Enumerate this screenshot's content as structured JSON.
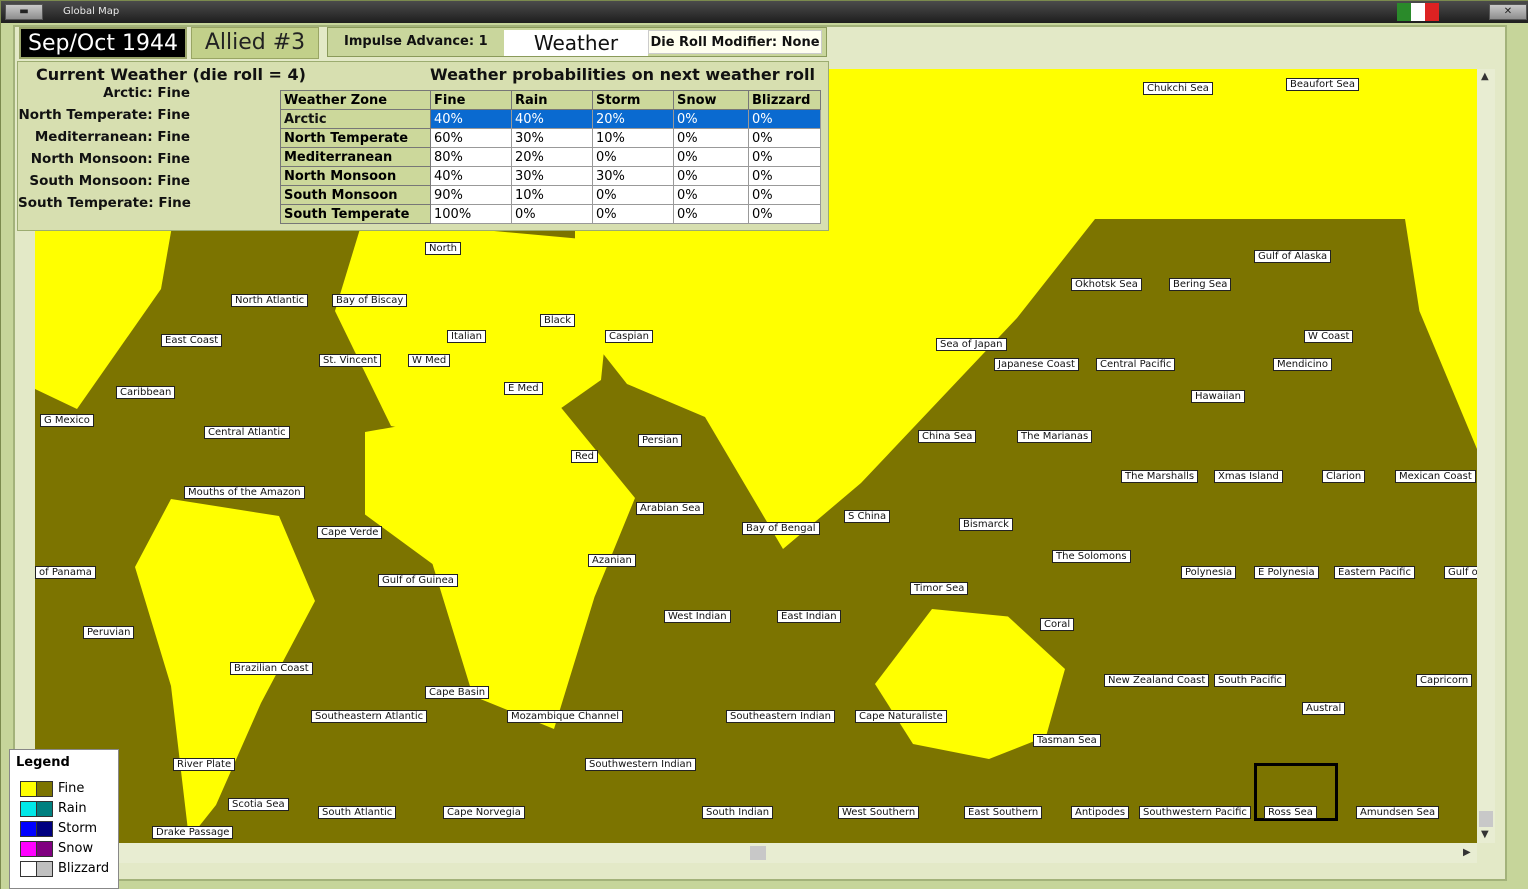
{
  "window": {
    "title": "Global Map",
    "minimize_label": "▬",
    "close_label": "✕"
  },
  "header": {
    "date": "Sep/Oct 1944",
    "side": "Allied #3",
    "impulse_advance": "Impulse Advance:  1",
    "weather_button": "Weather",
    "die_roll_modifier": "Die Roll Modifier:  None"
  },
  "current_weather": {
    "title": "Current Weather (die roll = 4)",
    "rows": [
      {
        "zone": "Arctic:",
        "value": "Fine"
      },
      {
        "zone": "North Temperate:",
        "value": "Fine"
      },
      {
        "zone": "Mediterranean:",
        "value": "Fine"
      },
      {
        "zone": "North Monsoon:",
        "value": "Fine"
      },
      {
        "zone": "South Monsoon:",
        "value": "Fine"
      },
      {
        "zone": "South Temperate:",
        "value": "Fine"
      }
    ]
  },
  "probabilities": {
    "title": "Weather probabilities on next weather roll",
    "headers": [
      "Weather Zone",
      "Fine",
      "Rain",
      "Storm",
      "Snow",
      "Blizzard"
    ],
    "rows": [
      [
        "Arctic",
        "40%",
        "40%",
        "20%",
        "0%",
        "0%"
      ],
      [
        "North Temperate",
        "60%",
        "30%",
        "10%",
        "0%",
        "0%"
      ],
      [
        "Mediterranean",
        "80%",
        "20%",
        "0%",
        "0%",
        "0%"
      ],
      [
        "North Monsoon",
        "40%",
        "30%",
        "30%",
        "0%",
        "0%"
      ],
      [
        "South Monsoon",
        "90%",
        "10%",
        "0%",
        "0%",
        "0%"
      ],
      [
        "South Temperate",
        "100%",
        "0%",
        "0%",
        "0%",
        "0%"
      ]
    ],
    "selected_row": "Arctic"
  },
  "map": {
    "colors": {
      "fine_land": "#ffff00",
      "fine_sea": "#7c7400"
    },
    "zones": [
      "Chukchi Sea",
      "Beaufort Sea",
      "North",
      "North Atlantic",
      "Bay of Biscay",
      "Black",
      "Caspian",
      "Italian",
      "East Coast",
      "St. Vincent",
      "W Med",
      "E Med",
      "Sea of Japan",
      "Okhotsk Sea",
      "Bering Sea",
      "Gulf of Alaska",
      "Japanese Coast",
      "Central Pacific",
      "W Coast",
      "Mendicino",
      "Caribbean",
      "Hawaiian",
      "G Mexico",
      "Central Atlantic",
      "Persian",
      "China Sea",
      "The Marianas",
      "Red",
      "The Marshalls",
      "Xmas Island",
      "Clarion",
      "Mexican Coast",
      "Mouths of the Amazon",
      "Arabian Sea",
      "S China",
      "Bismarck",
      "Cape Verde",
      "Bay of Bengal",
      "Azanian",
      "The Solomons",
      "of Panama",
      "Gulf of Guinea",
      "Polynesia",
      "E Polynesia",
      "Eastern Pacific",
      "Gulf o",
      "Timor Sea",
      "West Indian",
      "East Indian",
      "Peruvian",
      "Coral",
      "Brazilian Coast",
      "New Zealand Coast",
      "South Pacific",
      "Capricorn",
      "Cape Basin",
      "Austral",
      "Southeastern Atlantic",
      "Mozambique Channel",
      "Southeastern Indian",
      "Cape Naturaliste",
      "Tasman Sea",
      "River Plate",
      "Southwestern Indian",
      "Scotia Sea",
      "South Atlantic",
      "Cape Norvegia",
      "South Indian",
      "West Southern",
      "East Southern",
      "Antipodes",
      "Southwestern Pacific",
      "Ross Sea",
      "Amundsen Sea",
      "Drake Passage"
    ]
  },
  "legend": {
    "title": "Legend",
    "items": [
      {
        "label": "Fine",
        "c1": "#ffff00",
        "c2": "#7c7400"
      },
      {
        "label": "Rain",
        "c1": "#00e8e8",
        "c2": "#008080"
      },
      {
        "label": "Storm",
        "c1": "#0000ff",
        "c2": "#000080"
      },
      {
        "label": "Snow",
        "c1": "#ff00ff",
        "c2": "#800080"
      },
      {
        "label": "Blizzard",
        "c1": "#ffffff",
        "c2": "#c0c0c0"
      }
    ]
  }
}
